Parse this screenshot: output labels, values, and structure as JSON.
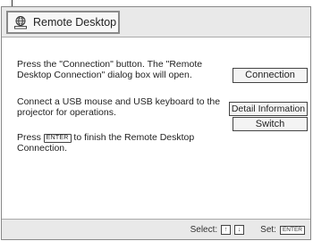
{
  "window": {
    "title": "Remote Desktop",
    "title_icon": "globe-icon"
  },
  "instructions": {
    "p1": "Press the \"Connection\" button. The \"Remote Desktop Connection\" dialog box will open.",
    "p2": "Connect a USB mouse and USB keyboard to the projector for operations.",
    "p3_before": "Press ",
    "p3_key": "ENTER",
    "p3_after": " to finish the Remote Desktop Connection."
  },
  "buttons": {
    "connection": "Connection",
    "detail": "Detail Information",
    "switch": "Switch"
  },
  "status": {
    "select_label": "Select:",
    "up_key": "↑",
    "down_key": "↓",
    "set_label": "Set:",
    "enter_key": "ENTER"
  }
}
